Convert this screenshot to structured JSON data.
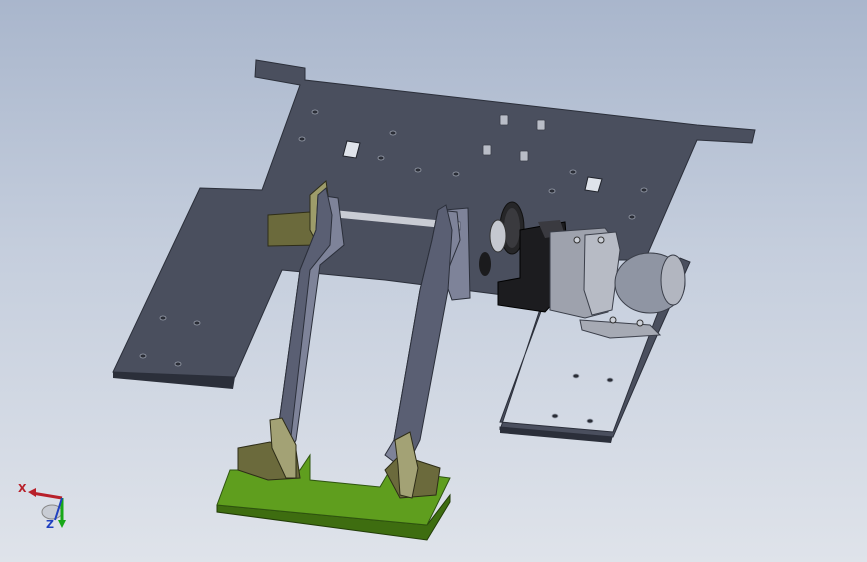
{
  "viewport": {
    "background_top": "#a9b6cc",
    "background_bottom": "#dfe3ea"
  },
  "model": {
    "plate_color": "#4a4f5e",
    "plate_edge_color": "#2b2f3a",
    "bracket_color": "#7e8399",
    "base_color": "#5f9e1e",
    "mount_color": "#6b6a3c",
    "motor_color": "#8f95a3",
    "gearbox_color": "#1c1c1f"
  },
  "triad": {
    "x_label": "X",
    "z_label": "Z",
    "x_color": "#b8202a",
    "y_color": "#18a818",
    "z_color": "#2040c0"
  }
}
